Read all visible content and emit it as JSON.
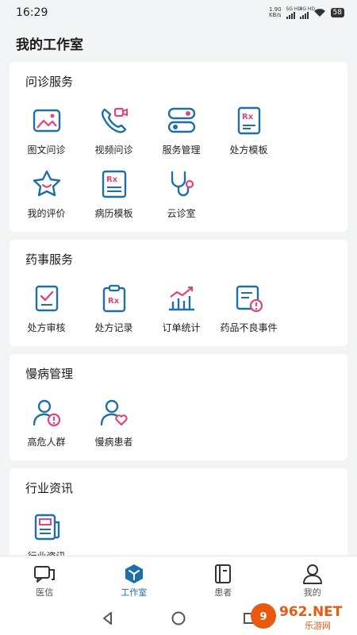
{
  "status": {
    "time": "16:29",
    "net_speed_top": "1.90",
    "net_speed_bottom": "KB/s",
    "sig1_label": "5G HD",
    "sig2_label": "4G HD",
    "battery": "58"
  },
  "page_title": "我的工作室",
  "sections": {
    "consult": {
      "title": "问诊服务",
      "items": [
        "图文问诊",
        "视频问诊",
        "服务管理",
        "处方模板",
        "我的评价",
        "病历模板",
        "云诊室"
      ]
    },
    "pharmacy": {
      "title": "药事服务",
      "items": [
        "处方审核",
        "处方记录",
        "订单统计",
        "药品不良事件"
      ]
    },
    "chronic": {
      "title": "慢病管理",
      "items": [
        "高危人群",
        "慢病患者"
      ]
    },
    "news": {
      "title": "行业资讯",
      "items": [
        "行业资讯"
      ]
    }
  },
  "tabbar": {
    "tabs": [
      "医信",
      "工作室",
      "患者",
      "我的"
    ],
    "active": "工作室"
  },
  "icons": {
    "accent_blue": "#1e6fa8",
    "accent_pink": "#e0457b"
  },
  "watermark": {
    "brand": "962.NET",
    "sub": "乐游网"
  }
}
